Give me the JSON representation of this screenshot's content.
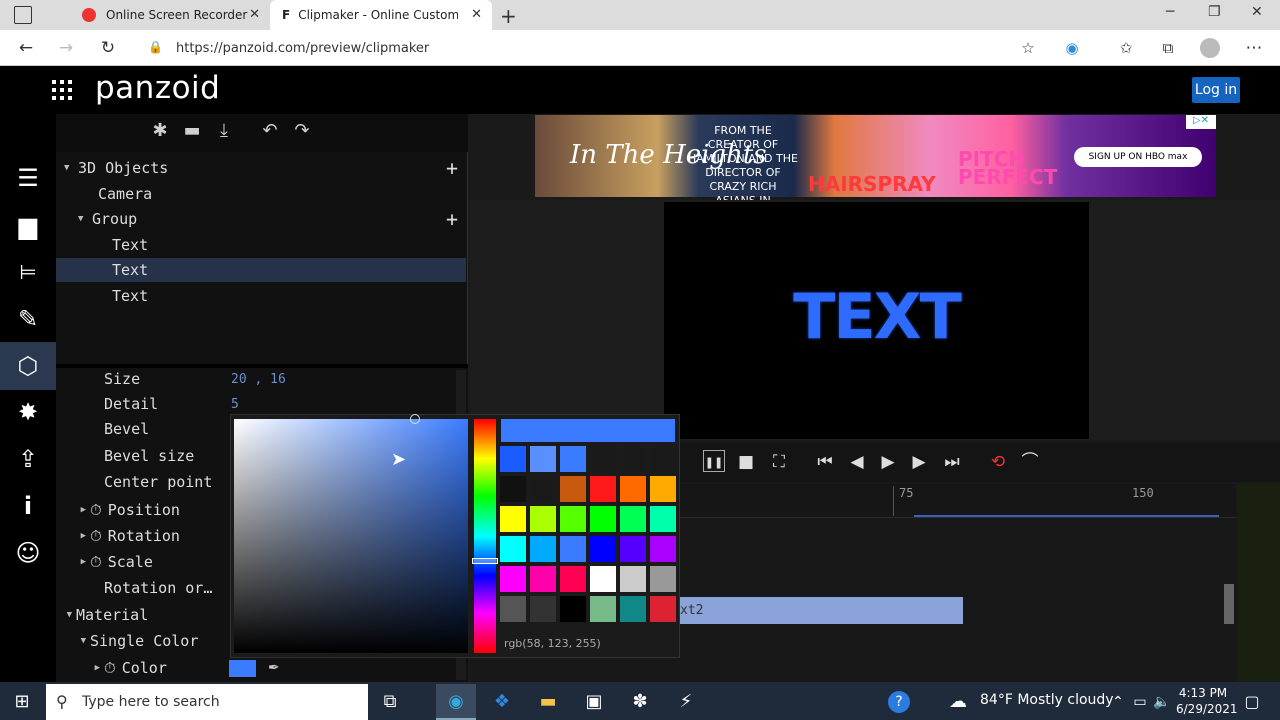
{
  "browser": {
    "tabs": [
      {
        "title": "Online Screen Recorder"
      },
      {
        "title": "Clipmaker - Online Custom Intro"
      }
    ],
    "url": "https://panzoid.com/preview/clipmaker",
    "window_controls": [
      "─",
      "❐",
      "✕"
    ]
  },
  "app": {
    "logo": "panzoid",
    "login_label": "Log in",
    "toolbar_icons": [
      "✱",
      "▬",
      "⤓",
      "↶",
      "↷"
    ],
    "tree": [
      {
        "label": "3D Objects",
        "indent": 0,
        "arrow": "▼",
        "plus": "+"
      },
      {
        "label": "Camera",
        "indent": 1,
        "arrow": "",
        "plus": ""
      },
      {
        "label": "Group",
        "indent": 1,
        "arrow": "▼",
        "plus": "+"
      },
      {
        "label": "Text",
        "indent": 2,
        "arrow": "",
        "plus": ""
      },
      {
        "label": "Text",
        "indent": 2,
        "arrow": "",
        "plus": "",
        "selected": true
      },
      {
        "label": "Text",
        "indent": 2,
        "arrow": "",
        "plus": ""
      }
    ],
    "properties": [
      {
        "label": "Size",
        "value": "20 , 16"
      },
      {
        "label": "Detail",
        "value": "5"
      },
      {
        "label": "Bevel",
        "value": ""
      },
      {
        "label": "Bevel size",
        "value": ""
      },
      {
        "label": "Center point",
        "value": ""
      },
      {
        "label": "Position",
        "value": "",
        "icon": "⏱"
      },
      {
        "label": "Rotation",
        "value": "",
        "icon": "⏱"
      },
      {
        "label": "Scale",
        "value": "",
        "icon": "⏱"
      },
      {
        "label": "Rotation or…",
        "value": ""
      },
      {
        "label": "Material",
        "value": ""
      },
      {
        "label": "Single Color",
        "value": ""
      },
      {
        "label": "Color",
        "value": "",
        "icon": "⏱"
      }
    ]
  },
  "ad": {
    "title": "In The Heights",
    "blurb": "FROM THE CREATOR OF HAMILTON AND THE DIRECTOR OF CRAZY RICH ASIANS IN THEATERS HBO max",
    "hairspray": "HAIRSPRAY",
    "pitch": "PITCH PERFECT",
    "cta": "SIGN UP ON HBO max",
    "close": "▷✕"
  },
  "preview": {
    "text": "TEXT"
  },
  "timeline": {
    "ticks": [
      "75",
      "150"
    ],
    "clip_label": "xt2"
  },
  "picker": {
    "rgb_text": "rgb(58, 123, 255)",
    "current_color": "#3a7bff",
    "swatches": [
      "#1a5cff",
      "#5a8fff",
      "#3a7bff",
      "#1a1a1a",
      "#1a1a1a",
      "#1a1a1a",
      "#111111",
      "#1a1a1a",
      "#c85a10",
      "#ff1a1a",
      "#ff6a00",
      "#ffaa00",
      "#ffff00",
      "#aaff00",
      "#55ff00",
      "#00ff00",
      "#00ff55",
      "#00ffaa",
      "#00ffff",
      "#00aaff",
      "#3a7bff",
      "#0000ff",
      "#5500ff",
      "#aa00ff",
      "#ff00ff",
      "#ff00aa",
      "#ff0055",
      "#ffffff",
      "#cccccc",
      "#999999",
      "#555555",
      "#333333",
      "#000000",
      "#77bb88",
      "#118888",
      "#dd2233"
    ]
  },
  "taskbar": {
    "search_placeholder": "Type here to search",
    "weather": "84°F  Mostly cloudy",
    "time": "4:13 PM",
    "date": "6/29/2021"
  }
}
